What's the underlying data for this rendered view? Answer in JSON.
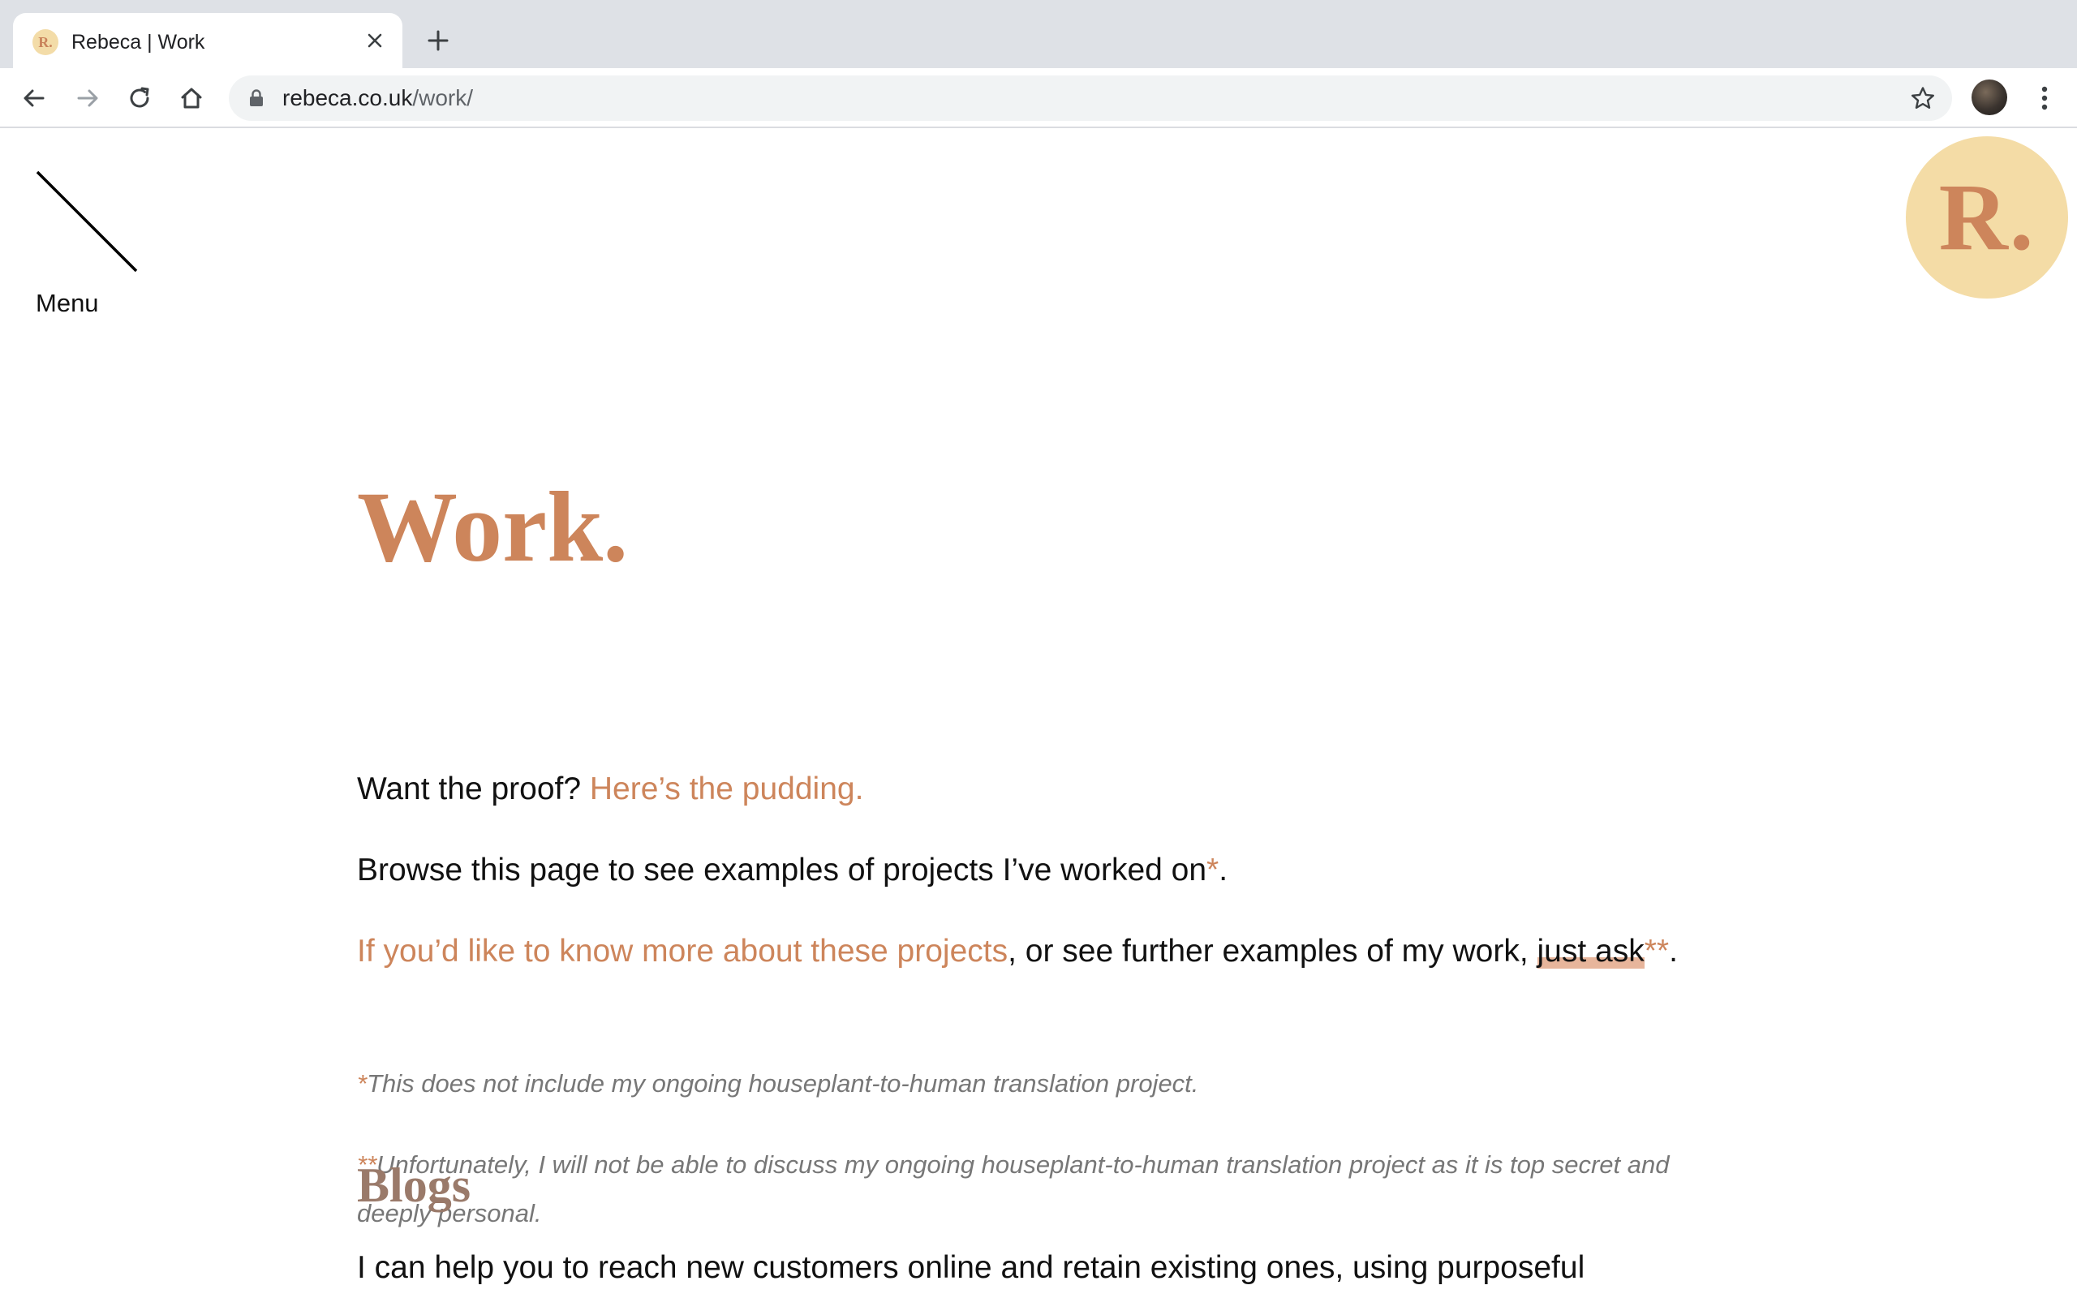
{
  "browser": {
    "tab_title": "Rebeca | Work",
    "tab_favicon_text": "R.",
    "url_domain": "rebeca.co.uk",
    "url_path": "/work/"
  },
  "page": {
    "menu_label": "Menu",
    "logo_text": "R.",
    "title": "Work.",
    "intro_text": "Want the proof? ",
    "intro_link": "Here’s the pudding.",
    "browse_text": "Browse this page to see examples of projects I’ve worked on",
    "browse_asterisk": "*",
    "browse_end": ".",
    "more_link": "If you’d like to know more about these projects",
    "more_text": ", or see further examples of my work, ",
    "just_ask_link": "just ask",
    "more_asterisks": "**",
    "more_end": ".",
    "note1_asterisk": "*",
    "note1_text": "This does not include my ongoing houseplant-to-human translation project.",
    "note2_asterisks": "**",
    "note2_text": "Unfortunately, I will not be able to discuss my ongoing houseplant-to-human translation project as it is top secret and deeply personal.",
    "section_heading": "Blogs",
    "section_text": "I can help you to reach new customers online and retain existing ones, using purposeful"
  },
  "colors": {
    "accent": "#cd855b",
    "logo_bg": "#f4dca6",
    "heading_muted": "#9a7a6a",
    "note_gray": "#777777"
  }
}
